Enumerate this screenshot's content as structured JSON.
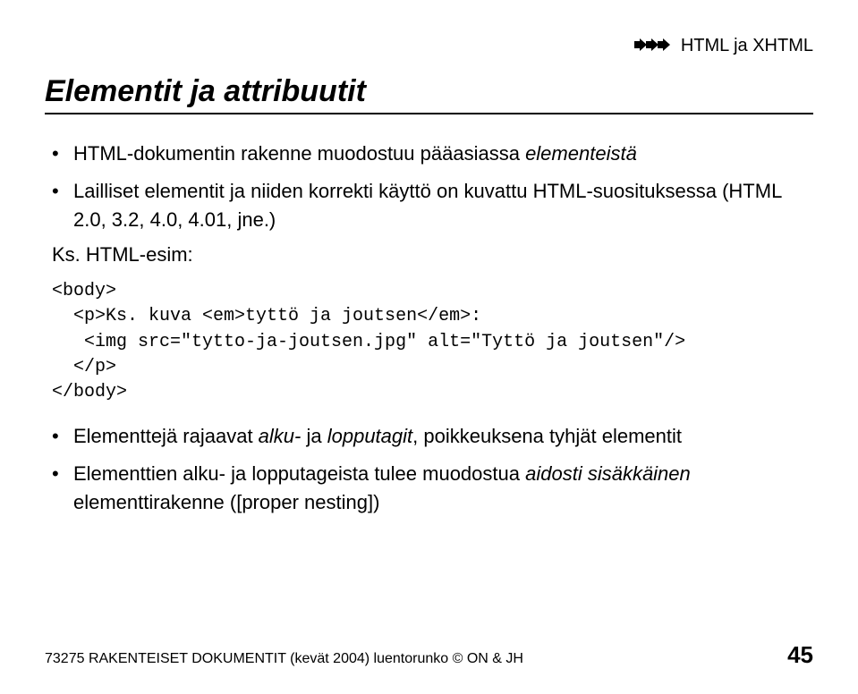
{
  "breadcrumb": "HTML ja XHTML",
  "title": "Elementit ja attribuutit",
  "bullet1_pre": "HTML-dokumentin rakenne muodostuu pääasiassa ",
  "bullet1_em": "elementeistä",
  "bullet2_pre": "Lailliset elementit ja niiden korrekti käyttö on kuvattu HTML-suosituksessa (HTML 2.0, 3.2, 4.0, 4.01, jne.)",
  "esim_label": "Ks. HTML-esim:",
  "code": "<body>\n  <p>Ks. kuva <em>tyttö ja joutsen</em>:\n   <img src=\"tytto-ja-joutsen.jpg\" alt=\"Tyttö ja joutsen\"/>\n  </p>\n</body>",
  "bullet3_pre": "Elementtejä rajaavat ",
  "bullet3_em1": "alku-",
  "bullet3_mid": " ja ",
  "bullet3_em2": "lopputagit",
  "bullet3_post": ", poikkeuksena tyhjät elementit",
  "bullet4_pre": "Elementtien alku- ja lopputageista tulee muodostua ",
  "bullet4_em": "aidosti sisäkkäinen",
  "bullet4_post": " elementtirakenne ([proper nesting])",
  "footer_left": "73275 RAKENTEISET DOKUMENTIT (kevät 2004) luentorunko © ON & JH",
  "footer_page": "45"
}
